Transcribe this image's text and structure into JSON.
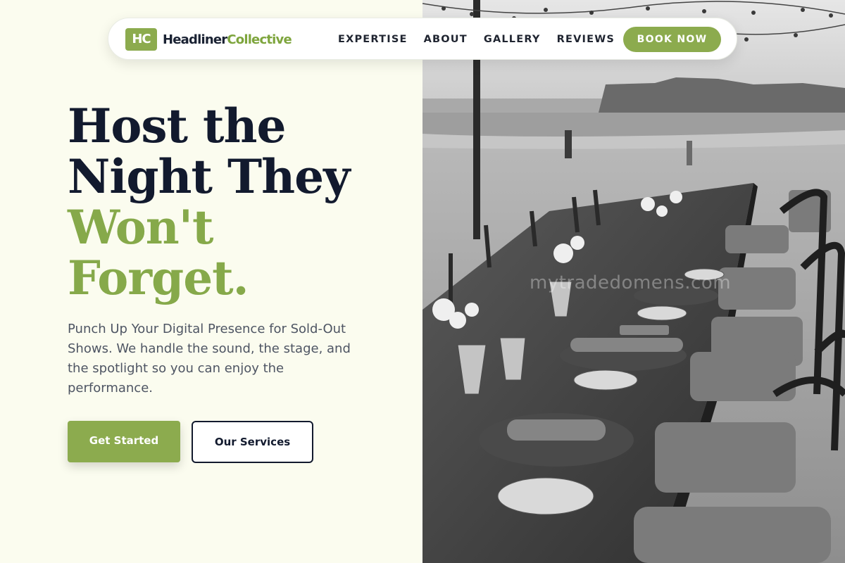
{
  "brand": {
    "mark": "HC",
    "name_part1": "Headliner",
    "name_part2": "Collective"
  },
  "nav": {
    "links": [
      "EXPERTISE",
      "ABOUT",
      "GALLERY",
      "REVIEWS"
    ],
    "cta_label": "BOOK NOW"
  },
  "hero": {
    "headline_dark_1": "Host the",
    "headline_dark_2": "Night They",
    "headline_accent_1": "Won't",
    "headline_accent_2": "Forget.",
    "subcopy": "Punch Up Your Digital Presence for Sold-Out Shows. We handle the sound, the stage, and the spotlight so you can enjoy the performance.",
    "primary_button": "Get Started",
    "secondary_button": "Our Services"
  },
  "photo": {
    "watermark": "mytradedomens.com"
  },
  "colors": {
    "accent": "#8cab4e",
    "headline_dark": "#121a2e",
    "background": "#fbfcef"
  }
}
